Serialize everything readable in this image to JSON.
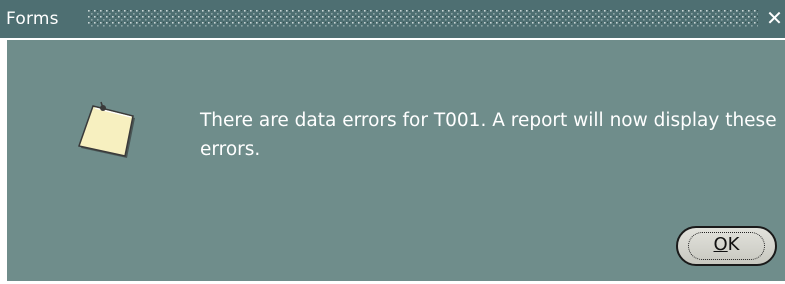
{
  "window": {
    "title": "Forms",
    "close_glyph": "✕"
  },
  "dialog": {
    "icon": "note-icon",
    "message": "There are data errors for T001. A report will now display these errors.",
    "ok_button": {
      "mnemonic": "O",
      "rest": "K"
    }
  },
  "colors": {
    "titlebar": "#4e6f72",
    "body": "#6f8d8b",
    "text": "#ffffff",
    "note_fill": "#f7f0c0"
  }
}
